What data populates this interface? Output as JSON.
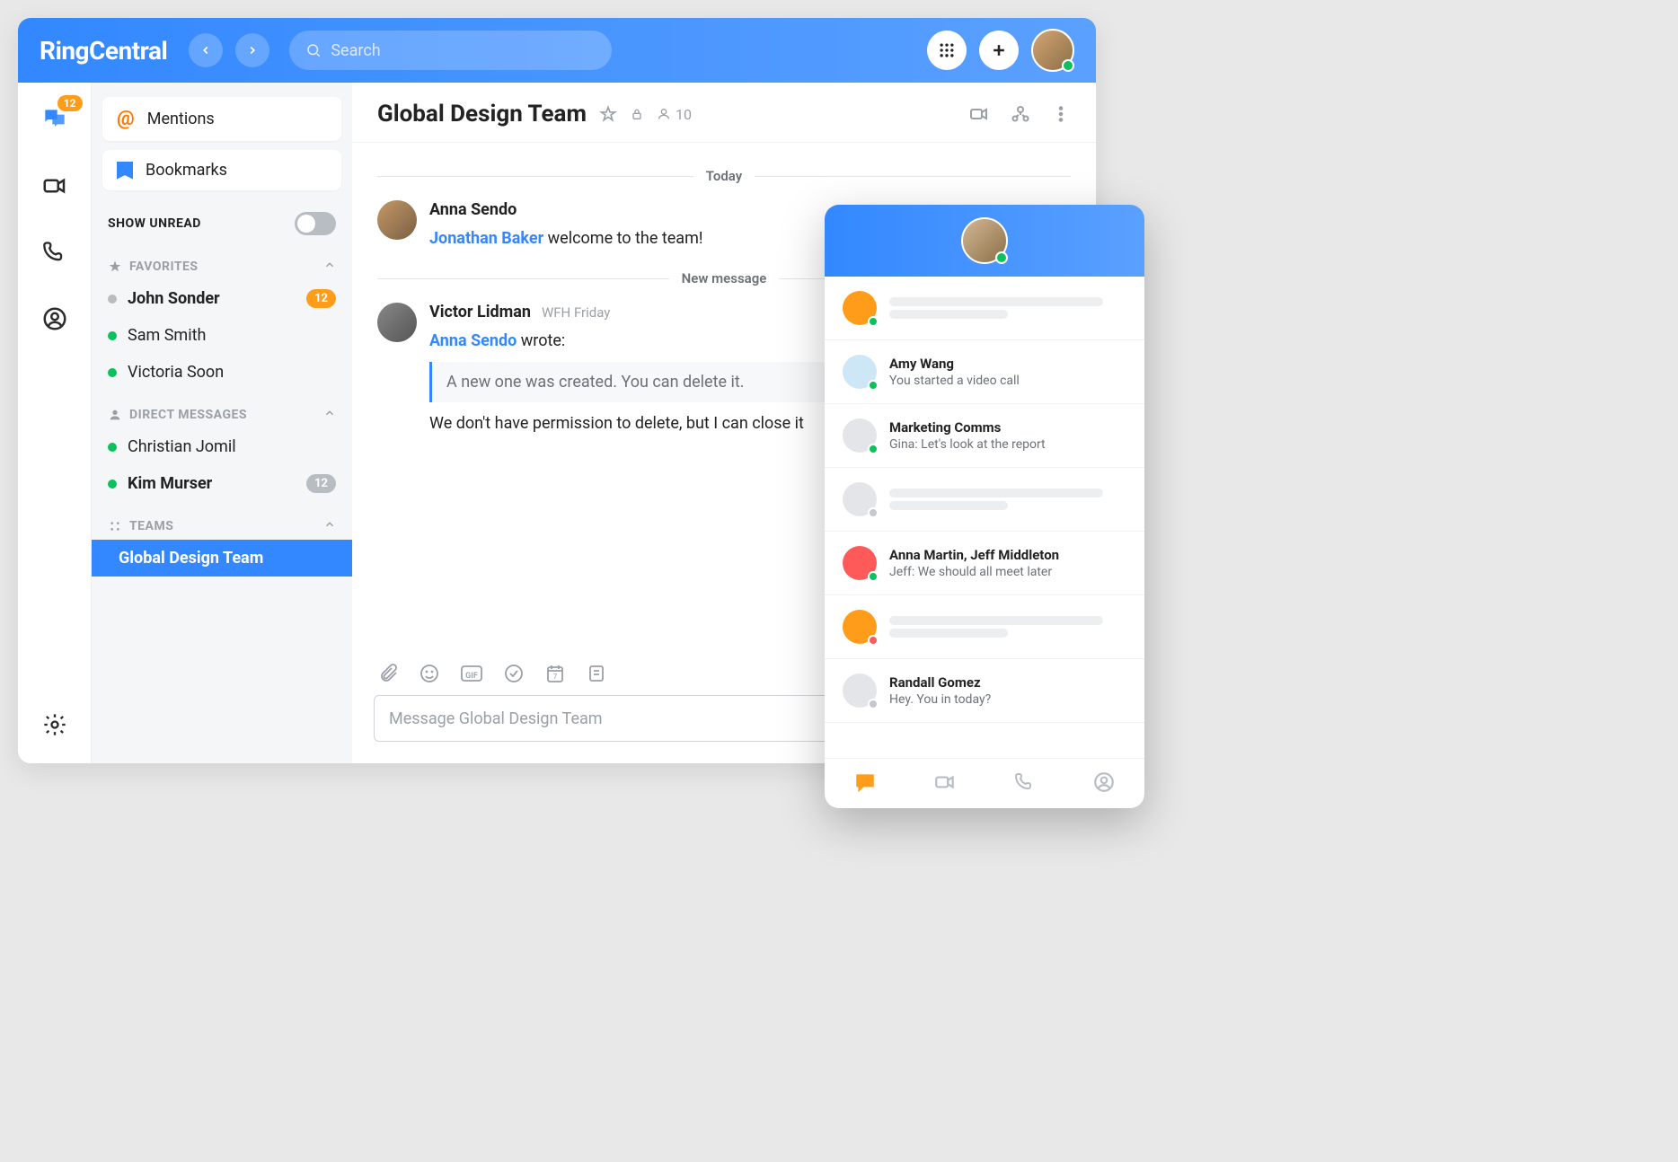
{
  "brand": "RingCentral",
  "search_placeholder": "Search",
  "rail": {
    "msg_badge": "12"
  },
  "sidebar": {
    "mentions": "Mentions",
    "bookmarks": "Bookmarks",
    "show_unread": "SHOW UNREAD",
    "sections": {
      "favorites": "FAVORITES",
      "dms": "DIRECT MESSAGES",
      "teams": "TEAMS"
    },
    "favorites": [
      {
        "name": "John Sonder",
        "bold": true,
        "online": false,
        "badge": "12",
        "badge_gray": false
      },
      {
        "name": "Sam Smith",
        "bold": false,
        "online": true
      },
      {
        "name": "Victoria Soon",
        "bold": false,
        "online": true
      }
    ],
    "dms": [
      {
        "name": "Christian Jomil",
        "bold": false,
        "online": true
      },
      {
        "name": "Kim Murser",
        "bold": true,
        "online": true,
        "badge": "12",
        "badge_gray": true
      }
    ],
    "teams": [
      {
        "name": "Global Design Team",
        "active": true
      }
    ]
  },
  "chat": {
    "title": "Global Design Team",
    "member_count": "10",
    "today": "Today",
    "new_message": "New message",
    "msg1": {
      "author": "Anna Sendo",
      "mention": "Jonathan Baker",
      "tail": " welcome to the team!"
    },
    "msg2": {
      "author": "Victor Lidman",
      "status": "WFH Friday",
      "quote_by": "Anna Sendo",
      "wrote": " wrote:",
      "quote_text": "A new one was created. You can delete it.",
      "text": "We don't have permission to delete, but I can close it"
    },
    "input_placeholder": "Message Global Design Team"
  },
  "mini": {
    "rows": [
      {
        "skeleton": true,
        "av": "#ff9c1a",
        "dot": "#0bc15c"
      },
      {
        "name": "Amy Wang",
        "sub": "You started a video call",
        "av": "#cde7f7",
        "dot": "#0bc15c"
      },
      {
        "name": "Marketing Comms",
        "sub": "Gina: Let's look at the report",
        "av": "#e3e5e8",
        "dot": "#0bc15c"
      },
      {
        "skeleton": true,
        "av": "#e3e5e8",
        "dot": "#c5c8cc"
      },
      {
        "name": "Anna Martin, Jeff Middleton",
        "sub": "Jeff: We should all meet later",
        "av": "#ff5a5a",
        "dot": "#0bc15c"
      },
      {
        "skeleton": true,
        "av": "#ff9c1a",
        "dot": "#ff5a5a"
      },
      {
        "name": "Randall Gomez",
        "sub": "Hey. You in today?",
        "av": "#e3e5e8",
        "dot": "#c5c8cc"
      }
    ]
  },
  "colors": {
    "accent": "#3388ff",
    "orange": "#ff9c1a",
    "green": "#0bc15c"
  }
}
